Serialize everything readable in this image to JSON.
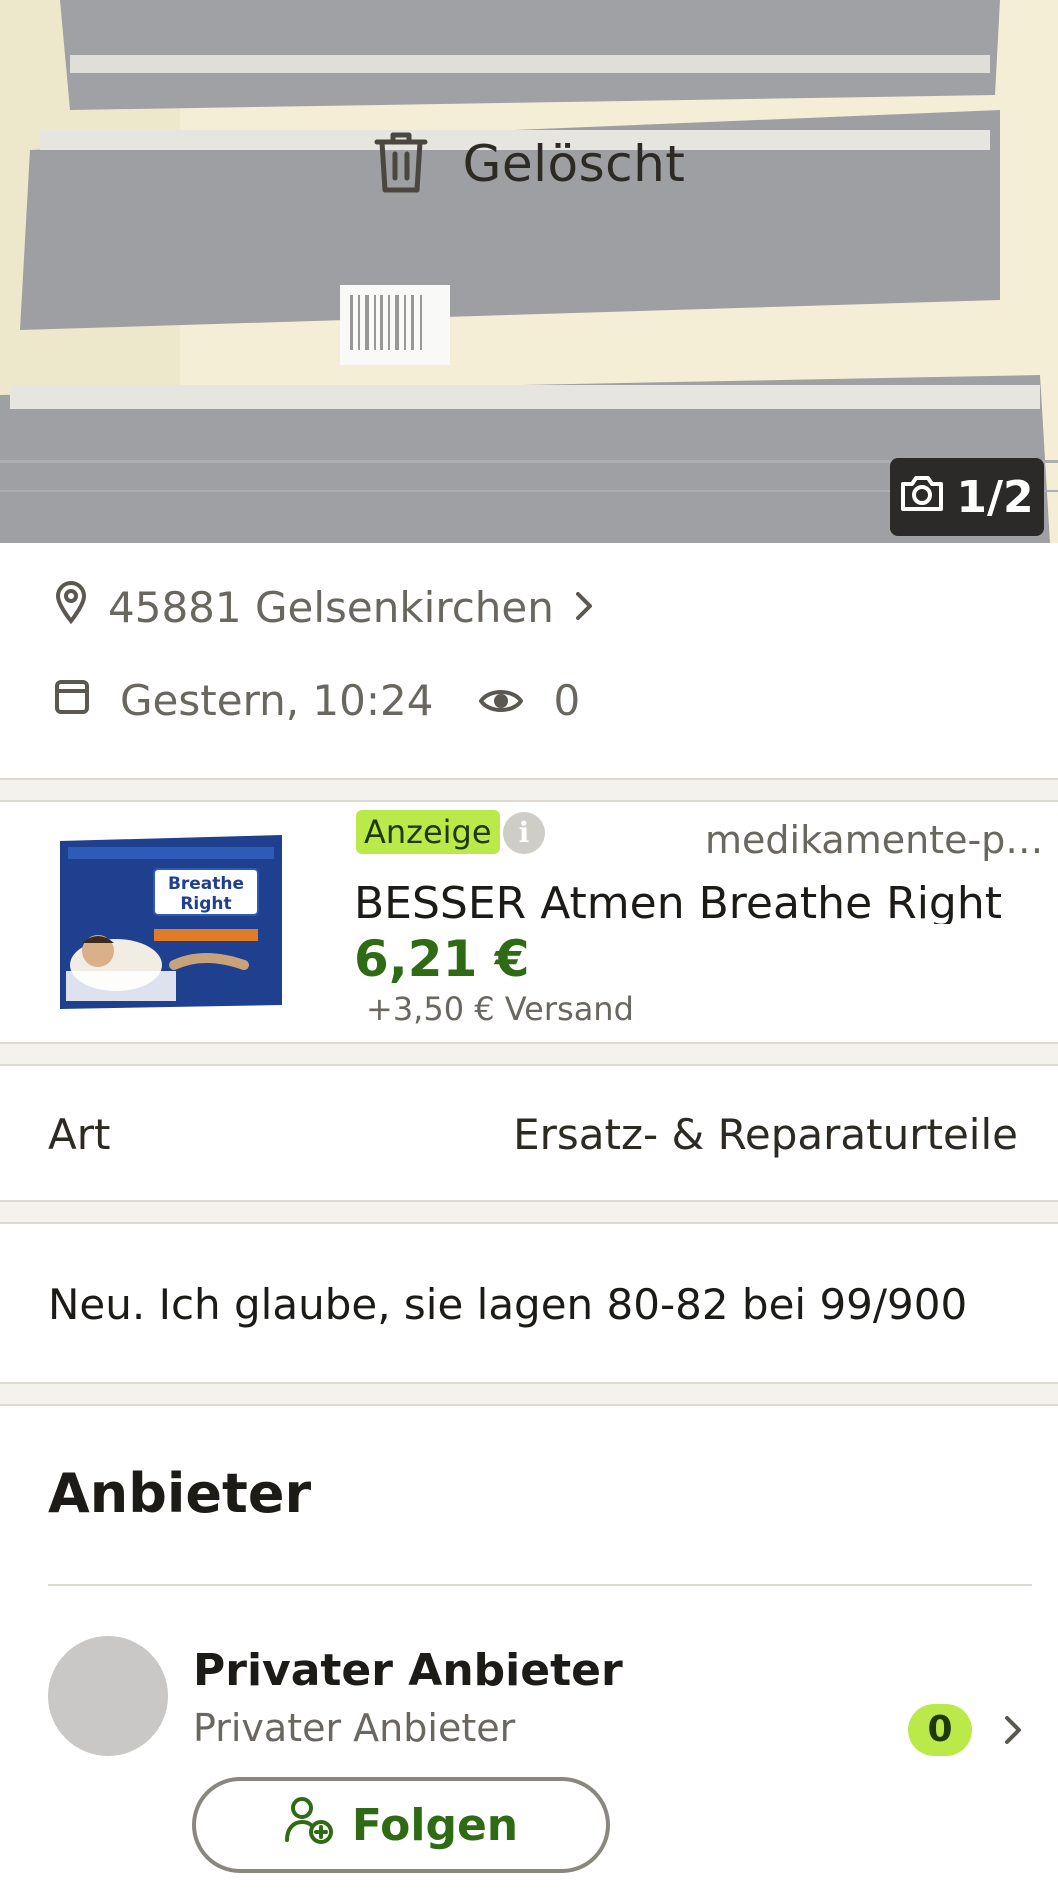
{
  "gallery": {
    "status_label": "Gelöscht",
    "counter": "1/2"
  },
  "listing": {
    "location": "45881 Gelsenkirchen",
    "posted": "Gestern, 10:24",
    "views": "0"
  },
  "ad": {
    "badge": "Anzeige",
    "info": "i",
    "seller": "medikamente-p…",
    "title": "BESSER Atmen Breathe Right",
    "price": "6,21 €",
    "shipping": "+3,50 € Versand",
    "thumb_brand_top": "Breathe",
    "thumb_brand_bottom": "Right"
  },
  "attributes": [
    {
      "key": "Art",
      "value": "Ersatz- & Reparaturteile"
    }
  ],
  "description": "Neu. Ich glaube, sie lagen 80-82 bei 99/900",
  "provider": {
    "section_title": "Anbieter",
    "name": "Privater Anbieter",
    "type": "Privater Anbieter",
    "score": "0",
    "follow_label": "Folgen"
  },
  "colors": {
    "accent_green": "#2f6b15",
    "badge_lime": "#b9ea4a"
  }
}
